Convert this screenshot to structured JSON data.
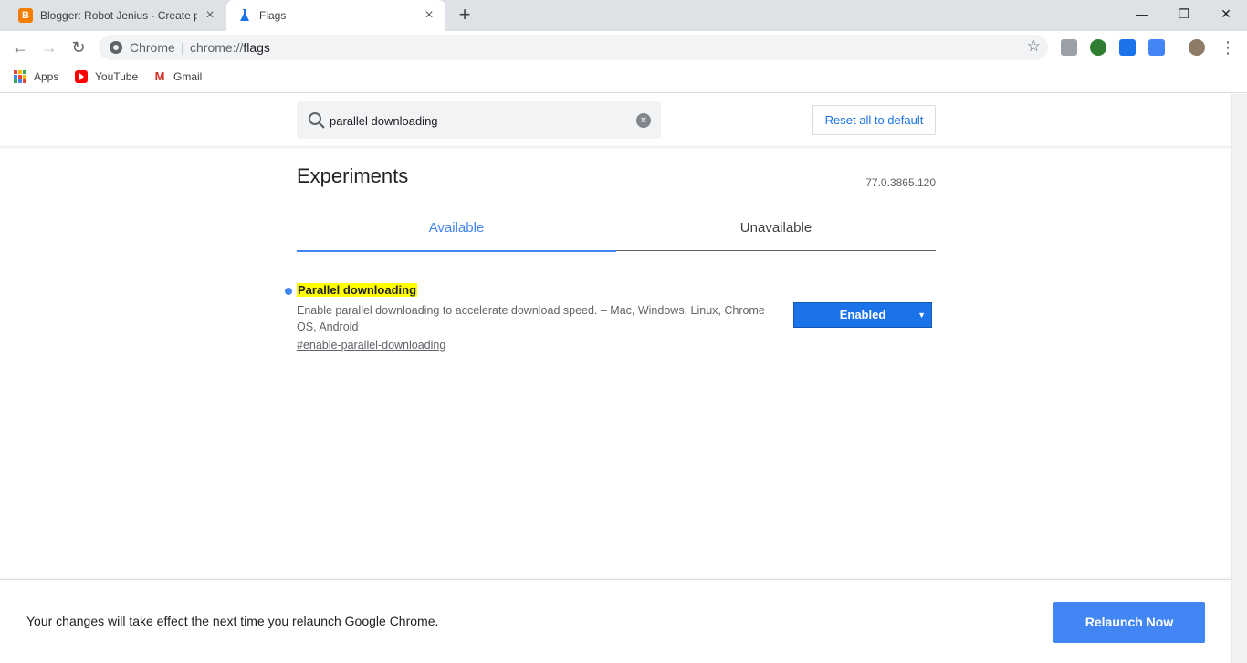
{
  "browser": {
    "tabs": [
      {
        "title": "Blogger: Robot Jenius - Create po",
        "favicon": "blogger-icon",
        "active": false
      },
      {
        "title": "Flags",
        "favicon": "flask-icon",
        "active": true
      }
    ],
    "omnibox": {
      "chip": "Chrome",
      "url_prefix": "chrome://",
      "url_host": "flags"
    },
    "bookmarks": [
      {
        "label": "Apps",
        "icon": "apps-grid-icon"
      },
      {
        "label": "YouTube",
        "icon": "youtube-icon"
      },
      {
        "label": "Gmail",
        "icon": "gmail-icon"
      }
    ]
  },
  "flags_page": {
    "search": {
      "value": "parallel downloading",
      "placeholder": "Search flags"
    },
    "reset_label": "Reset all to default",
    "title": "Experiments",
    "version": "77.0.3865.120",
    "tabs": {
      "available": "Available",
      "unavailable": "Unavailable"
    },
    "flag": {
      "name": "Parallel downloading",
      "description": "Enable parallel downloading to accelerate download speed. – Mac, Windows, Linux, Chrome OS, Android",
      "permalink": "#enable-parallel-downloading",
      "state": "Enabled"
    },
    "footer": {
      "message": "Your changes will take effect the next time you relaunch Google Chrome.",
      "relaunch_label": "Relaunch Now"
    }
  },
  "colors": {
    "accent": "#1a73e8",
    "highlight": "#ffff00",
    "relaunch": "#4285f4"
  }
}
